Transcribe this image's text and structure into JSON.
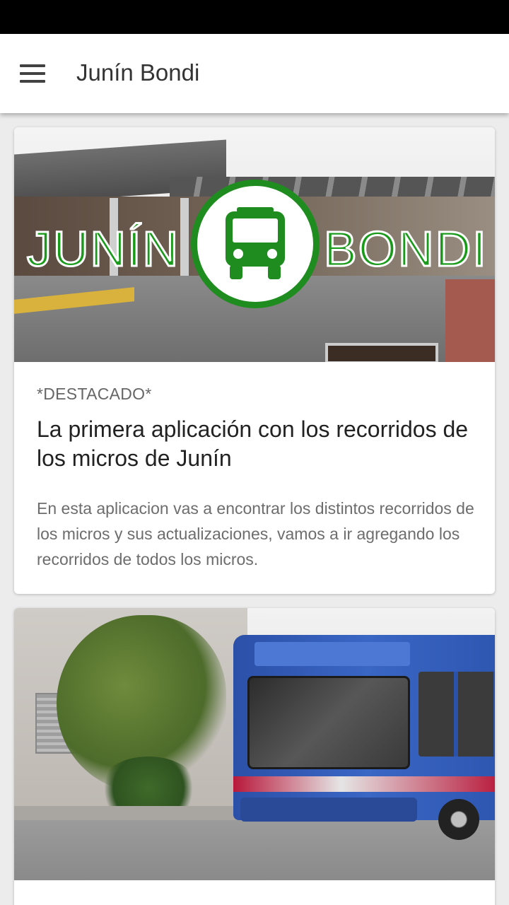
{
  "app_bar": {
    "title": "Junín Bondi",
    "menu_icon": "menu-icon"
  },
  "feed": [
    {
      "image_alt_icon": "bus-icon",
      "logo_left": "JUNÍN",
      "logo_right": "BONDI",
      "tag": "*DESTACADO*",
      "headline": "La primera aplicación con los recorridos de los micros de Junín",
      "description": "En esta aplicacion vas a encontrar los distintos recorridos de los micros y sus actualizaciones, vamos a ir agregando los recorridos de todos los micros."
    },
    {
      "image_subject": "city-bus-photo"
    }
  ],
  "colors": {
    "logo_green": "#1a9a1a",
    "bus_blue": "#3a66c4",
    "app_bar_bg": "#ffffff",
    "status_bar_bg": "#000000"
  }
}
